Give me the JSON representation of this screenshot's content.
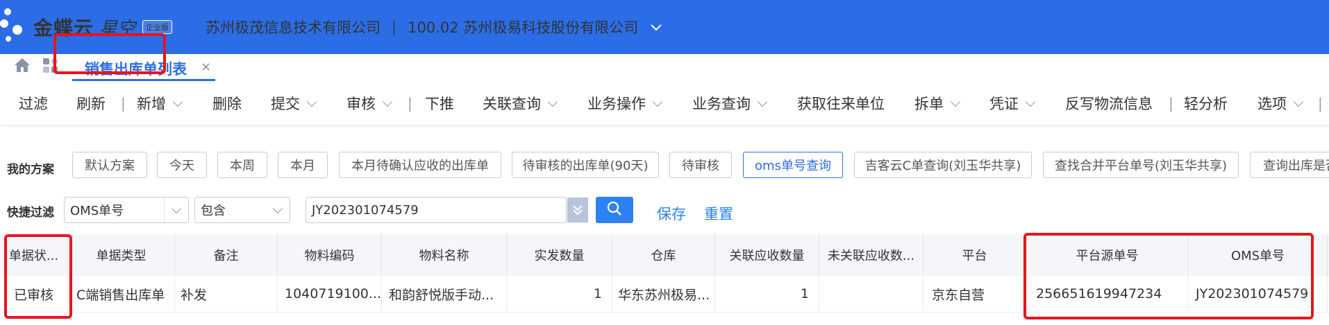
{
  "header": {
    "brand": "金蝶云",
    "brand_sub": "星空",
    "edition": "企业版",
    "company": "苏州极茂信息技术有限公司",
    "separator": "|",
    "org": "100.02 苏州极易科技股份有限公司",
    "header_color": "#2b6de6"
  },
  "tabs": {
    "active_label": "销售出库单列表",
    "close": "×"
  },
  "toolbar": {
    "items": [
      "过滤",
      "刷新",
      "新增",
      "删除",
      "提交",
      "审核",
      "下推",
      "关联查询",
      "业务操作",
      "业务查询",
      "获取往来单位",
      "拆单",
      "凭证",
      "反写物流信息",
      "轻分析",
      "选项"
    ],
    "separator": "|"
  },
  "schemes": {
    "label": "我的方案",
    "items": [
      "默认方案",
      "今天",
      "本周",
      "本月",
      "本月待确认应收的出库单",
      "待审核的出库单(90天)",
      "待审核",
      "oms单号查询",
      "吉客云C单查询(刘玉华共享)",
      "查找合并平台单号(刘玉华共享)",
      "查询出库是否"
    ],
    "active": "oms单号查询"
  },
  "quick_filter": {
    "label": "快捷过滤",
    "field": "OMS单号",
    "operator": "包含",
    "value": "JY202301074579",
    "save": "保存",
    "reset": "重置"
  },
  "table": {
    "columns": [
      "单据状...",
      "单据类型",
      "备注",
      "物料编码",
      "物料名称",
      "实发数量",
      "仓库",
      "关联应收数量",
      "未关联应收数...",
      "平台",
      "平台源单号",
      "OMS单号"
    ],
    "rows": [
      [
        "已审核",
        "C端销售出库单",
        "补发",
        "1040719100...",
        "和韵舒悦版手动...",
        "1",
        "华东苏州极易...",
        "1",
        "",
        "京东自营",
        "256651619947234",
        "JY202301074579"
      ]
    ]
  },
  "highlight_color": "#e8141b"
}
